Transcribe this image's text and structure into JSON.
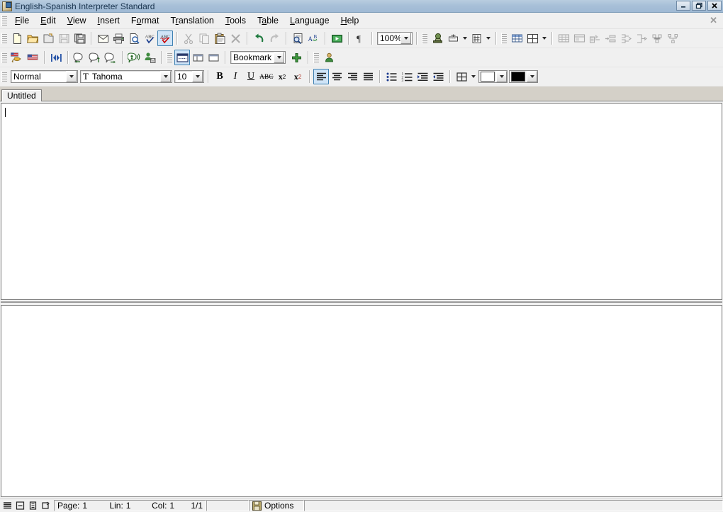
{
  "window": {
    "title": "English-Spanish Interpreter Standard",
    "icon": "app-icon",
    "minimize_label": "_",
    "restore_label": "❐",
    "close_label": "✕",
    "document_close_label": "✕"
  },
  "menubar": {
    "items": [
      {
        "label": "File",
        "accel": "F"
      },
      {
        "label": "Edit",
        "accel": "E"
      },
      {
        "label": "View",
        "accel": "V"
      },
      {
        "label": "Insert",
        "accel": "I"
      },
      {
        "label": "Format",
        "accel": "o"
      },
      {
        "label": "Translation",
        "accel": "r"
      },
      {
        "label": "Tools",
        "accel": "T"
      },
      {
        "label": "Table",
        "accel": "a"
      },
      {
        "label": "Language",
        "accel": "L"
      },
      {
        "label": "Help",
        "accel": "H"
      }
    ]
  },
  "toolbar_standard": {
    "zoom_value": "100%",
    "buttons": [
      {
        "name": "new-document-icon",
        "tip": "New"
      },
      {
        "name": "open-folder-icon",
        "tip": "Open"
      },
      {
        "name": "open-document-icon",
        "tip": "Open Document"
      },
      {
        "name": "save-icon",
        "tip": "Save",
        "disabled": true
      },
      {
        "name": "save-all-icon",
        "tip": "Save All"
      },
      {
        "name": "mail-icon",
        "tip": "Send Mail"
      },
      {
        "name": "print-icon",
        "tip": "Print"
      },
      {
        "name": "print-preview-icon",
        "tip": "Print Preview"
      },
      {
        "name": "spellcheck-icon",
        "tip": "Spelling"
      },
      {
        "name": "spellcheck-auto-icon",
        "tip": "Auto Spelling",
        "selected": true
      },
      {
        "name": "cut-icon",
        "tip": "Cut",
        "disabled": true
      },
      {
        "name": "copy-icon",
        "tip": "Copy",
        "disabled": true
      },
      {
        "name": "paste-icon",
        "tip": "Paste"
      },
      {
        "name": "delete-icon",
        "tip": "Delete",
        "disabled": true
      },
      {
        "name": "undo-icon",
        "tip": "Undo"
      },
      {
        "name": "redo-icon",
        "tip": "Redo",
        "disabled": true
      },
      {
        "name": "find-icon",
        "tip": "Find"
      },
      {
        "name": "replace-icon",
        "tip": "Replace"
      },
      {
        "name": "media-play-icon",
        "tip": "Play"
      },
      {
        "name": "show-formatting-icon",
        "tip": "Show Formatting Marks"
      },
      {
        "name": "stamp-icon",
        "tip": "Stamp"
      },
      {
        "name": "insert-field-icon",
        "tip": "Insert Field"
      },
      {
        "name": "number-field-icon",
        "tip": "Number Field"
      },
      {
        "name": "table-grid-icon",
        "tip": "Table Grid"
      },
      {
        "name": "table-layout-icon",
        "tip": "Table Layout"
      },
      {
        "name": "insert-table-icon",
        "tip": "Insert Table"
      },
      {
        "name": "table-borders-icon",
        "tip": "Table Borders"
      },
      {
        "name": "table-properties-icon",
        "tip": "Table Properties",
        "disabled": true
      },
      {
        "name": "table-autoformat-icon",
        "tip": "Table AutoFormat",
        "disabled": true
      },
      {
        "name": "table-sort-icon",
        "tip": "Sort",
        "disabled": true
      },
      {
        "name": "insert-row-icon",
        "tip": "Insert Row",
        "disabled": true
      },
      {
        "name": "merge-cells-icon",
        "tip": "Merge Cells",
        "disabled": true
      },
      {
        "name": "split-cells-icon",
        "tip": "Split Cells",
        "disabled": true
      },
      {
        "name": "distribute-rows-icon",
        "tip": "Distribute Rows",
        "disabled": true
      },
      {
        "name": "distribute-columns-icon",
        "tip": "Distribute Columns",
        "disabled": true
      }
    ]
  },
  "toolbar_translation": {
    "bookmark_value": "Bookmark",
    "buttons": [
      {
        "name": "translate-to-spanish-icon",
        "tip": "Translate"
      },
      {
        "name": "flag-icon",
        "tip": "Language Flag"
      },
      {
        "name": "align-segments-icon",
        "tip": "Align Segments"
      },
      {
        "name": "comment-previous-icon",
        "tip": "Previous Comment"
      },
      {
        "name": "comment-up-icon",
        "tip": "Comment Up"
      },
      {
        "name": "comment-next-icon",
        "tip": "Next Comment"
      },
      {
        "name": "speak-icon",
        "tip": "Speak"
      },
      {
        "name": "user-save-icon",
        "tip": "User Save"
      },
      {
        "name": "pane-layout-full-icon",
        "tip": "Full View",
        "selected": true
      },
      {
        "name": "pane-layout-split-icon",
        "tip": "Split View"
      },
      {
        "name": "pane-layout-single-icon",
        "tip": "Single View"
      },
      {
        "name": "add-bookmark-icon",
        "tip": "Add Bookmark"
      },
      {
        "name": "user-icon",
        "tip": "User"
      }
    ]
  },
  "toolbar_formatting": {
    "style_value": "Normal",
    "font_value": "Tahoma",
    "size_value": "10",
    "highlight_color": "#ffffff",
    "font_color": "#000000",
    "bold_label": "B",
    "italic_label": "I",
    "underline_label": "U",
    "strike_label": "ABC",
    "subscript_label": "x",
    "subscript_sub": "2",
    "superscript_label": "x",
    "superscript_sup": "2",
    "buttons": [
      {
        "name": "align-left-icon",
        "selected": true
      },
      {
        "name": "align-center-icon"
      },
      {
        "name": "align-right-icon"
      },
      {
        "name": "align-justify-icon"
      },
      {
        "name": "bullet-list-icon"
      },
      {
        "name": "numbered-list-icon"
      },
      {
        "name": "increase-indent-icon"
      },
      {
        "name": "decrease-indent-icon"
      },
      {
        "name": "borders-icon"
      },
      {
        "name": "highlight-color-icon"
      },
      {
        "name": "font-color-icon"
      }
    ]
  },
  "tabs": [
    {
      "label": "Untitled",
      "active": true
    }
  ],
  "statusbar": {
    "view_icons": [
      {
        "name": "normal-view-icon"
      },
      {
        "name": "page-layout-view-icon"
      },
      {
        "name": "outline-view-icon"
      },
      {
        "name": "web-layout-view-icon"
      }
    ],
    "page_label": "Page:",
    "page_value": "1",
    "line_label": "Lin:",
    "line_value": "1",
    "col_label": "Col:",
    "col_value": "1",
    "pages_value": "1/1",
    "options_label": "Options",
    "options_icon": "save-options-icon"
  },
  "colors": {
    "title_bar": "#a8c0d8",
    "toolbar_bg": "#f0f0f0",
    "tabstrip_bg": "#d4d0c8",
    "pane_bg": "#ffffff",
    "selected_btn": "#cfe4f7",
    "selected_border": "#3c7fb1"
  }
}
